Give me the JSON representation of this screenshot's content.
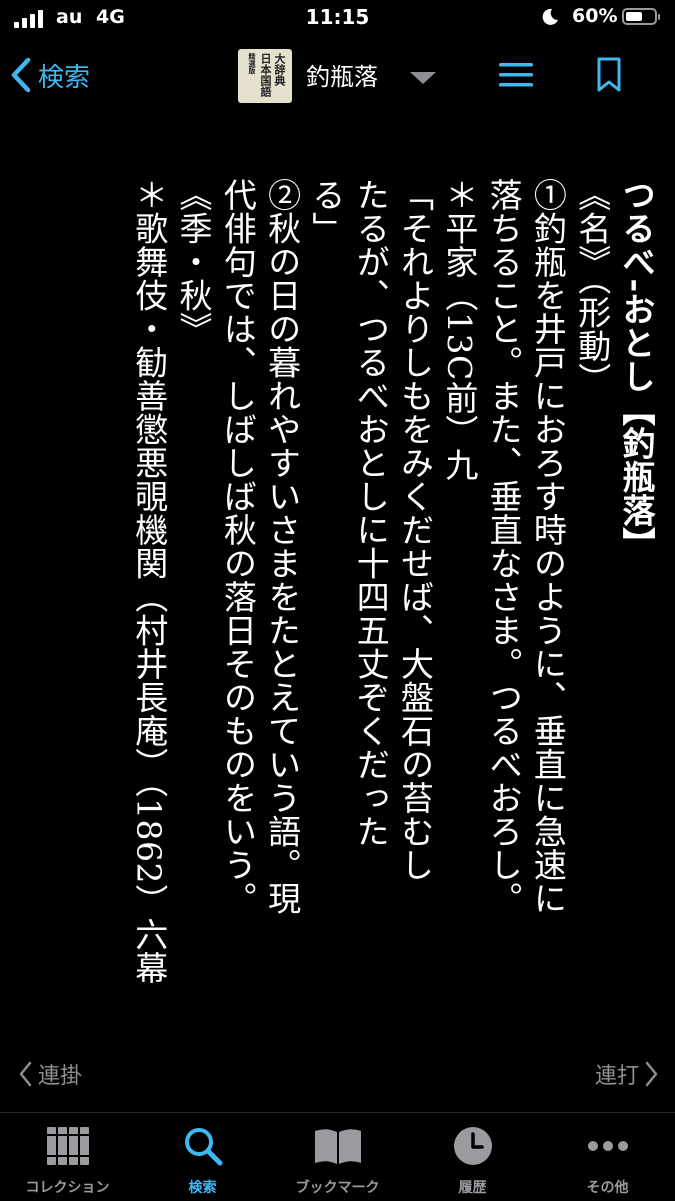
{
  "status_bar": {
    "carrier": "au",
    "network": "4G",
    "time": "11:15",
    "battery_percent": "60%",
    "battery_level": 0.6,
    "signal_bars": 4
  },
  "nav": {
    "back_label": "検索",
    "dictionary_title": "釣瓶落",
    "book_icon_text": [
      "精選版",
      "日本国語",
      "大辞典"
    ]
  },
  "entry": {
    "headword": "つるべ‐おとし【釣瓶落】",
    "lines": [
      "《名》（形動）",
      "①釣瓶を井戸におろす時のように、垂直に急速に",
      "落ちること。また、垂直なさま。つるべおろし。",
      "＊平家（13C前）九",
      "「それよりしもをみくだせば、大盤石の苔むし",
      "たるが、つるべおとしに十四五丈ぞくだった",
      "る」",
      "②秋の日の暮れやすいさまをたとえていう語。現",
      "代俳句では、しばしば秋の落日そのものをいう。",
      "《季・秋》",
      "＊歌舞伎・勧善懲悪覗機関（村井長庵）（1862）六幕"
    ]
  },
  "pager": {
    "prev_label": "連掛",
    "next_label": "連打"
  },
  "tabs": [
    {
      "label": "コレクション",
      "icon": "collection-icon"
    },
    {
      "label": "検索",
      "icon": "search-icon"
    },
    {
      "label": "ブックマーク",
      "icon": "bookmark-book-icon"
    },
    {
      "label": "履歴",
      "icon": "history-clock-icon"
    },
    {
      "label": "その他",
      "icon": "more-icon"
    }
  ],
  "colors": {
    "accent": "#3fb8f2",
    "inactive": "#9a9a9f",
    "background": "#000000"
  }
}
